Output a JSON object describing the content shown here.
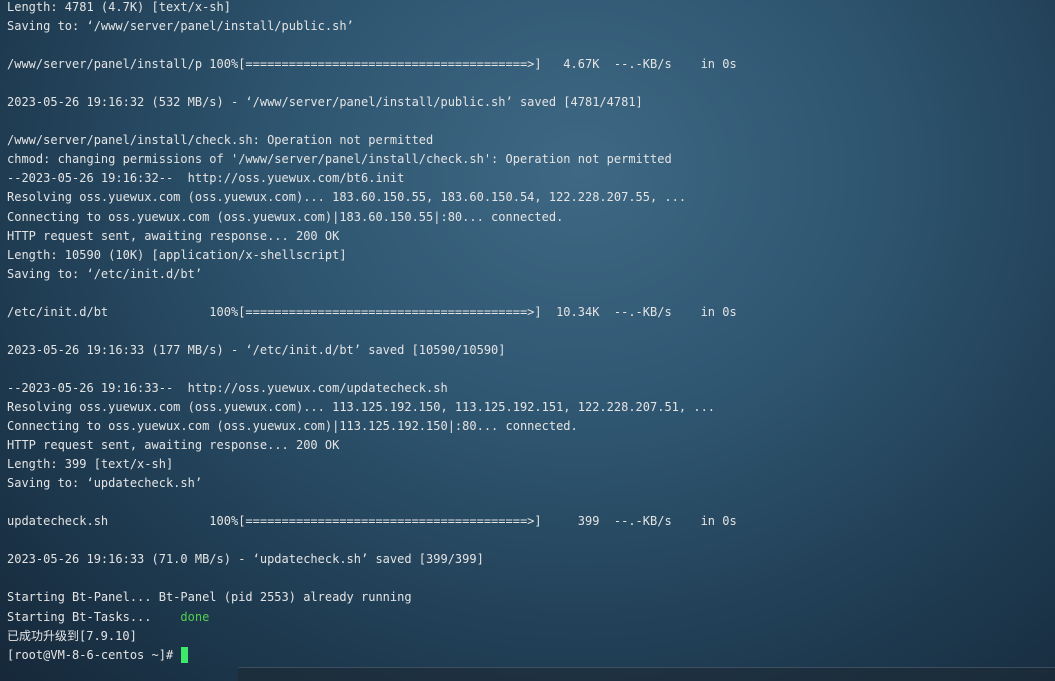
{
  "terminal": {
    "lines": [
      "Length: 4781 (4.7K) [text/x-sh]",
      "Saving to: ‘/www/server/panel/install/public.sh’",
      "",
      "/www/server/panel/install/p 100%[=======================================>]   4.67K  --.-KB/s    in 0s",
      "",
      "2023-05-26 19:16:32 (532 MB/s) - ‘/www/server/panel/install/public.sh’ saved [4781/4781]",
      "",
      "/www/server/panel/install/check.sh: Operation not permitted",
      "chmod: changing permissions of '/www/server/panel/install/check.sh': Operation not permitted",
      "--2023-05-26 19:16:32--  http://oss.yuewux.com/bt6.init",
      "Resolving oss.yuewux.com (oss.yuewux.com)... 183.60.150.55, 183.60.150.54, 122.228.207.55, ...",
      "Connecting to oss.yuewux.com (oss.yuewux.com)|183.60.150.55|:80... connected.",
      "HTTP request sent, awaiting response... 200 OK",
      "Length: 10590 (10K) [application/x-shellscript]",
      "Saving to: ‘/etc/init.d/bt’",
      "",
      "/etc/init.d/bt              100%[=======================================>]  10.34K  --.-KB/s    in 0s",
      "",
      "2023-05-26 19:16:33 (177 MB/s) - ‘/etc/init.d/bt’ saved [10590/10590]",
      "",
      "--2023-05-26 19:16:33--  http://oss.yuewux.com/updatecheck.sh",
      "Resolving oss.yuewux.com (oss.yuewux.com)... 113.125.192.150, 113.125.192.151, 122.228.207.51, ...",
      "Connecting to oss.yuewux.com (oss.yuewux.com)|113.125.192.150|:80... connected.",
      "HTTP request sent, awaiting response... 200 OK",
      "Length: 399 [text/x-sh]",
      "Saving to: ‘updatecheck.sh’",
      "",
      "updatecheck.sh              100%[=======================================>]     399  --.-KB/s    in 0s",
      "",
      "2023-05-26 19:16:33 (71.0 MB/s) - ‘updatecheck.sh’ saved [399/399]",
      "",
      "Starting Bt-Panel... Bt-Panel (pid 2553) already running"
    ],
    "tasks_line": {
      "prefix": "Starting Bt-Tasks...    ",
      "status": "done"
    },
    "upgrade_line": "已成功升级到[7.9.10]",
    "prompt": "[root@VM-8-6-centos ~]#",
    "status_color": "#4fd04f",
    "cursor_color": "#3ee86a"
  }
}
